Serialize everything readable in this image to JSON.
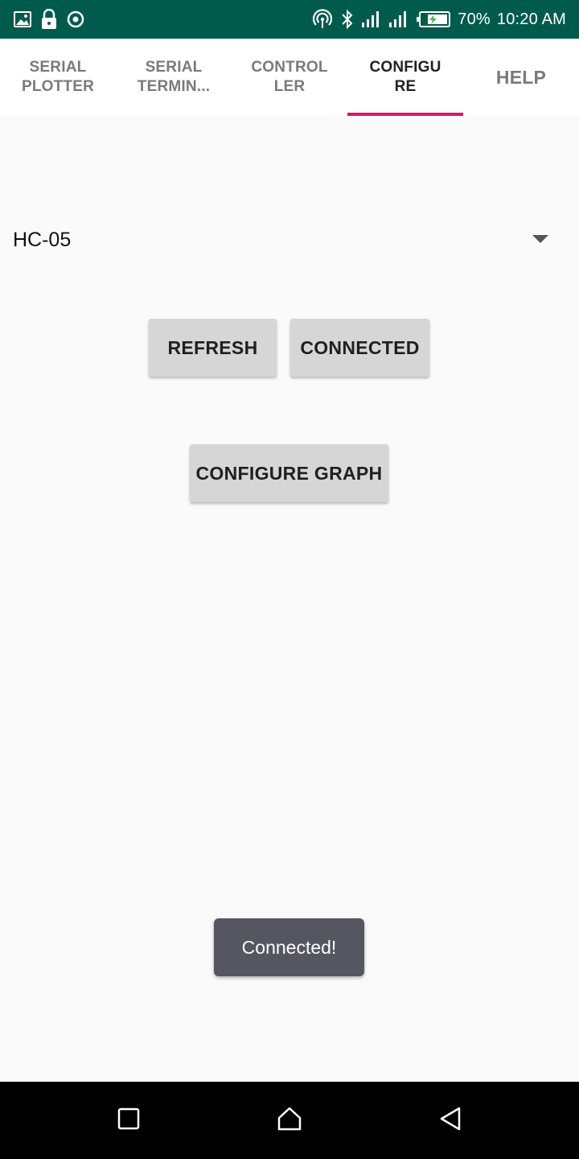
{
  "status_bar": {
    "left_icons": [
      "image-icon",
      "lock-icon",
      "sync-icon"
    ],
    "right_icons": [
      "hotspot-icon",
      "bluetooth-icon",
      "signal-icon",
      "signal-icon",
      "battery-icon"
    ],
    "battery": "70%",
    "time": "10:20 AM",
    "background": "#005b4d"
  },
  "tabs": [
    {
      "label": "SERIAL\nPLOTTER",
      "active": false
    },
    {
      "label": "SERIAL\nTERMIN...",
      "active": false
    },
    {
      "label": "CONTROL\nLER",
      "active": false
    },
    {
      "label": "CONFIGU\nRE",
      "active": true
    },
    {
      "label": "HELP",
      "active": false
    }
  ],
  "accent_color": "#d81b60",
  "device_spinner": {
    "selected": "HC-05",
    "icon": "dropdown-arrow-icon"
  },
  "buttons": {
    "refresh": "REFRESH",
    "connected": "CONNECTED",
    "configure_graph": "CONFIGURE GRAPH"
  },
  "toast": "Connected!",
  "nav_bar": {
    "icons": [
      "recents-icon",
      "home-icon",
      "back-icon"
    ]
  }
}
